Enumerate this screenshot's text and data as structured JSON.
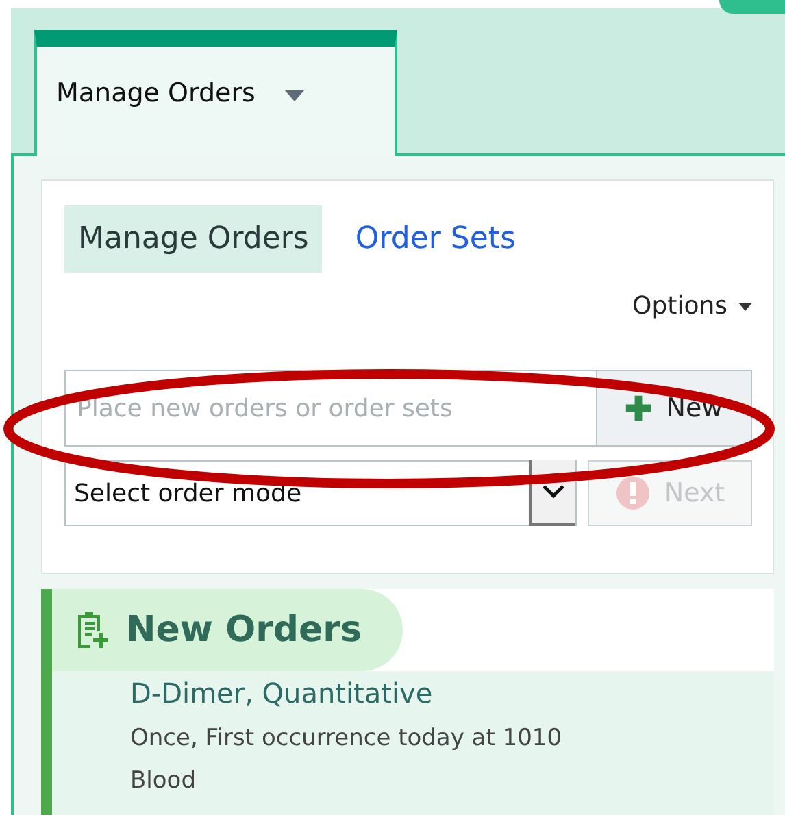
{
  "activity_tab": {
    "label": "Manage Orders",
    "selected": true
  },
  "subtabs": [
    {
      "label": "Manage Orders",
      "selected": true
    },
    {
      "label": "Order Sets",
      "selected": false
    }
  ],
  "options_menu": {
    "label": "Options"
  },
  "order_search": {
    "placeholder": "Place new orders or order sets"
  },
  "new_button": {
    "label": "New",
    "disabled": false
  },
  "order_mode": {
    "value": "Select order mode"
  },
  "next_button": {
    "label": "Next",
    "disabled": true
  },
  "section": {
    "title": "New Orders",
    "orders": [
      {
        "name": "D-Dimer, Quantitative",
        "details": [
          "Once, First occurrence today at 1010",
          "Blood"
        ]
      }
    ]
  },
  "annotations": [
    {
      "kind": "ellipse",
      "color": "#c00000"
    }
  ]
}
